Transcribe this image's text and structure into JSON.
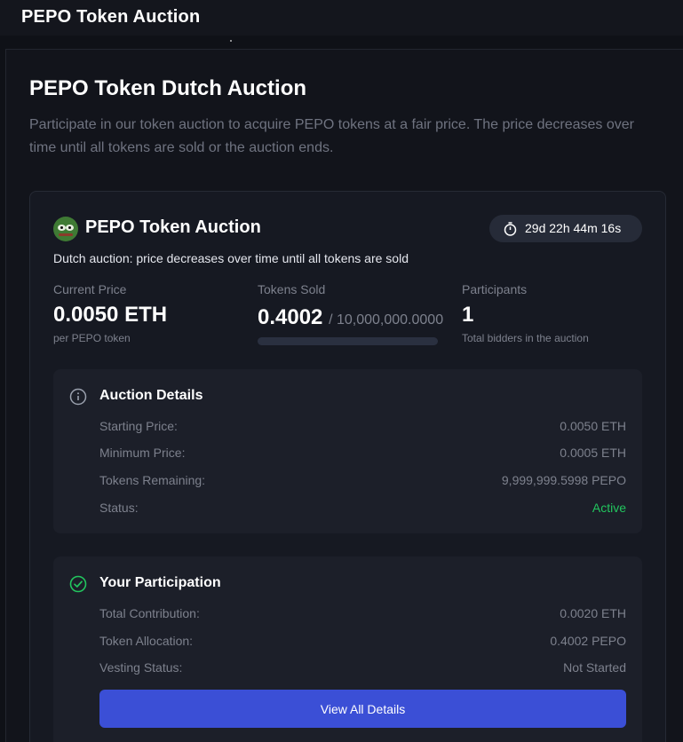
{
  "app": {
    "title": "PEPO Token Auction"
  },
  "page": {
    "title": "PEPO Token Dutch Auction",
    "description": "Participate in our token auction to acquire PEPO tokens at a fair price. The price decreases over time until all tokens are sold or the auction ends."
  },
  "auction": {
    "title": "PEPO Token Auction",
    "timer": "29d 22h 44m 16s",
    "subtitle": "Dutch auction: price decreases over time until all tokens are sold",
    "current_price": {
      "label": "Current Price",
      "value": "0.0050 ETH",
      "foot": "per PEPO token"
    },
    "tokens_sold": {
      "label": "Tokens Sold",
      "value": "0.4002",
      "total": "/ 10,000,000.0000",
      "progress": 0.0
    },
    "participants": {
      "label": "Participants",
      "value": "1",
      "foot": "Total bidders in the auction"
    }
  },
  "details": {
    "title": "Auction Details",
    "icon": "info-icon",
    "rows": [
      {
        "label": "Starting Price:",
        "value": "0.0050 ETH"
      },
      {
        "label": "Minimum Price:",
        "value": "0.0005 ETH"
      },
      {
        "label": "Tokens Remaining:",
        "value": "9,999,999.5998 PEPO"
      },
      {
        "label": "Status:",
        "value": "Active"
      }
    ],
    "status_color": "#22c55e"
  },
  "participation": {
    "title": "Your Participation",
    "icon": "check-circle-icon",
    "rows": [
      {
        "label": "Total Contribution:",
        "value": "0.0020 ETH"
      },
      {
        "label": "Token Allocation:",
        "value": "0.4002 PEPO"
      },
      {
        "label": "Vesting Status:",
        "value": "Not Started"
      }
    ],
    "button_label": "View All Details"
  },
  "colors": {
    "accent": "#3b4fd6",
    "background": "#0f1117",
    "success": "#22c55e"
  }
}
